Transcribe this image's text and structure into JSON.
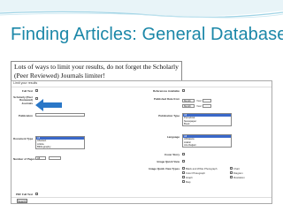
{
  "slide": {
    "title": "Finding Articles: General Database",
    "callout": "Lots of ways to limit your results, do not forget the Scholarly (Peer Reviewed) Journals limiter!"
  },
  "screenshot": {
    "header": "Limit your results",
    "search_button": "Search",
    "left_fields": [
      {
        "label": "Full Text"
      },
      {
        "label": "Scholarly (Peer Reviewed) Journals"
      },
      {
        "label": "Publication"
      },
      {
        "label": "Document Type",
        "options": [
          "All",
          "Abstract",
          "Article",
          "Bibliography"
        ]
      },
      {
        "label": "Number of Pages",
        "value": "All"
      },
      {
        "label": "PDF Full Text"
      }
    ],
    "right_fields": [
      {
        "label": "References Available"
      },
      {
        "label": "Published Date from",
        "month": "Month",
        "year_label": "Year:",
        "to_month": "Month"
      },
      {
        "label": "Publication Type",
        "options": [
          "All",
          "Periodical",
          "Newspaper",
          "Book"
        ]
      },
      {
        "label": "Language",
        "options": [
          "All",
          "Afrikaans",
          "Arabic",
          "Azerbaijani"
        ]
      },
      {
        "label": "Cover Story"
      },
      {
        "label": "Image Quick View"
      },
      {
        "label": "Image Quick View Types",
        "radios": [
          "Black and White Photograph",
          "Color Photograph",
          "Graph",
          "Map",
          "Chart",
          "Diagram",
          "Illustration"
        ]
      }
    ],
    "colors": {
      "title": "#1b87a8",
      "arrow": "#2a77c7",
      "selected": "#3a68c9"
    }
  }
}
